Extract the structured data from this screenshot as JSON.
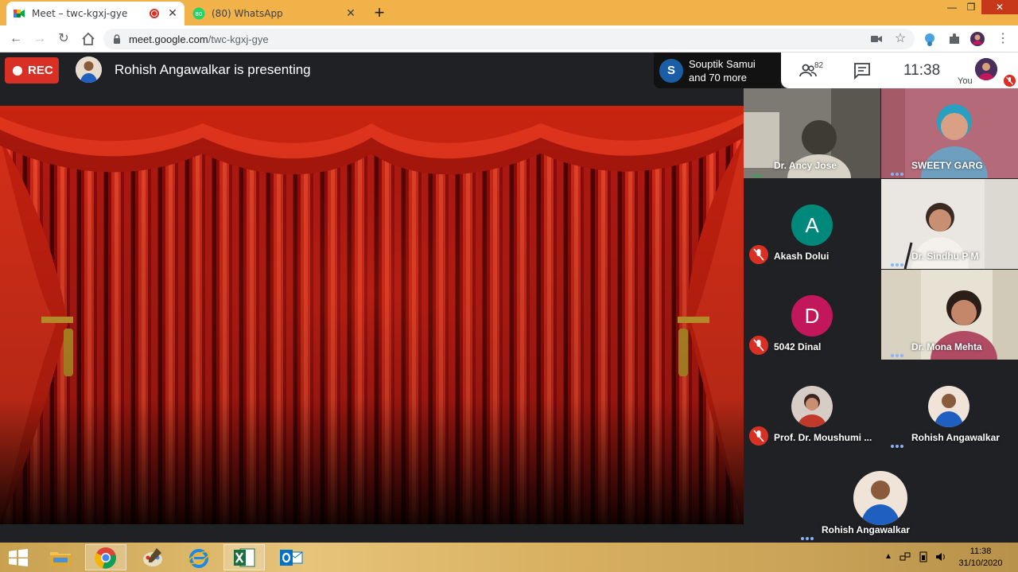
{
  "browser": {
    "tabs": [
      {
        "title": "Meet – twc-kgxj-gye",
        "active": true,
        "recording": true
      },
      {
        "title": "(80) WhatsApp",
        "active": false,
        "badge": "80"
      }
    ],
    "new_tab": "+",
    "window_controls": {
      "minimize": "—",
      "maximize": "❐",
      "close": "✕"
    },
    "url_host": "meet.google.com",
    "url_path": "/twc-kgxj-gye"
  },
  "meet": {
    "rec_label": "REC",
    "presenting_text": "Rohish Angawalkar is presenting",
    "participants_chip": {
      "initial": "S",
      "line1": "Souptik Samui",
      "line2": "and 70 more"
    },
    "people_count": "82",
    "clock": "11:38",
    "you_label": "You",
    "tiles": [
      {
        "name": "Dr. Ancy Jose",
        "state": "speaking"
      },
      {
        "name": "SWEETY GARG",
        "state": "dots"
      },
      {
        "name": "Akash Dolui",
        "state": "muted",
        "initial": "A",
        "color": "#00897b"
      },
      {
        "name": "Dr. Sindhu P M",
        "state": "dots"
      },
      {
        "name": "5042 Dinal",
        "state": "muted",
        "initial": "D",
        "color": "#c2185b"
      },
      {
        "name": "Dr. Mona Mehta",
        "state": "dots"
      },
      {
        "name": "Prof. Dr. Moushumi ...",
        "state": "muted"
      },
      {
        "name": "Rohish Angawalkar",
        "state": "dots"
      },
      {
        "name": "Rohish Angawalkar",
        "state": "dots"
      }
    ]
  },
  "taskbar": {
    "apps": [
      "start-button",
      "file-explorer",
      "chrome",
      "paint",
      "internet-explorer",
      "excel",
      "outlook"
    ],
    "time": "11:38",
    "date": "31/10/2020"
  },
  "colors": {
    "accent_red": "#d93025",
    "meet_bg": "#202124",
    "tab_strip": "#f1b24a"
  }
}
